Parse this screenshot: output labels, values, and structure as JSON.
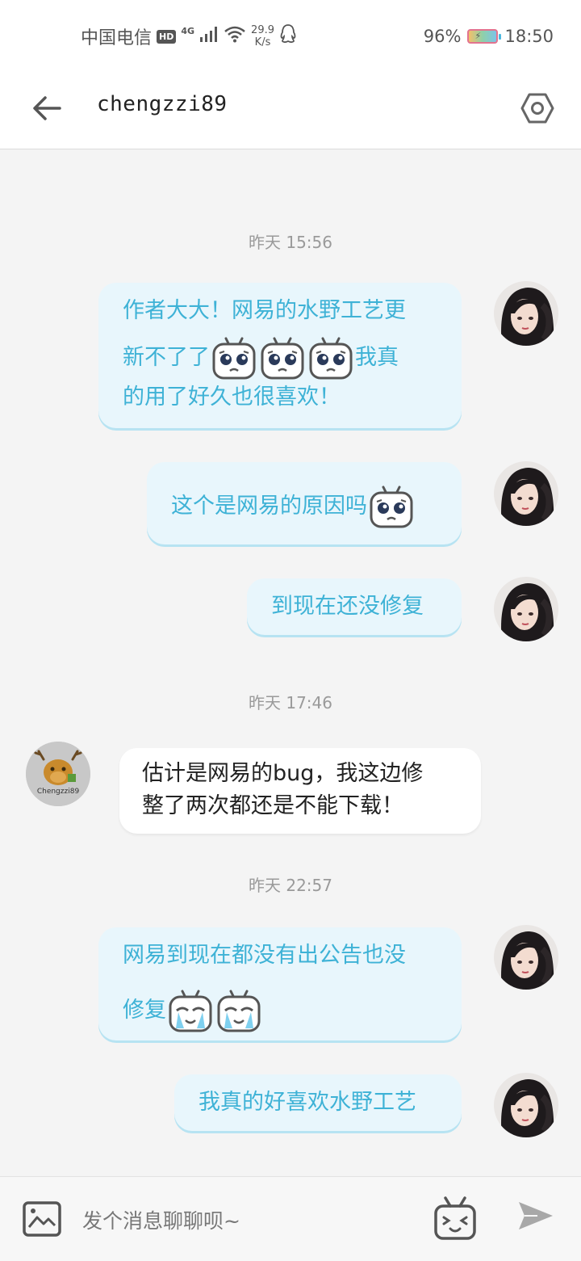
{
  "status_bar": {
    "carrier": "中国电信",
    "hd_badge": "HD",
    "network": "4G",
    "speed_value": "29.9",
    "speed_unit": "K/s",
    "battery": "96%",
    "time": "18:50",
    "icons": [
      "hd-badge-icon",
      "signal-icon",
      "wifi-icon",
      "qq-notification-icon",
      "battery-charging-icon"
    ]
  },
  "header": {
    "back_icon": "arrow-left-icon",
    "title": "chengzzi89",
    "settings_icon": "hexagon-settings-icon"
  },
  "colors": {
    "outgoing_bubble_bg": "#e8f6fc",
    "outgoing_text": "#3eb2d6",
    "incoming_bubble_bg": "#ffffff",
    "incoming_text": "#222222",
    "timestamp_text": "#9a9a9a",
    "page_bg": "#f4f4f4"
  },
  "messages": {
    "time_1": "昨天 15:56",
    "m1": {
      "line1": "作者大大！网易的水野工艺更",
      "line2a": "新不了了",
      "line2b": "我真",
      "line3": "的用了好久也很喜欢！",
      "emoji": "crying-tv-emoji"
    },
    "m2": {
      "text": "这个是网易的原因吗",
      "emoji": "crying-tv-emoji"
    },
    "m3": {
      "text": "到现在还没修复"
    },
    "time_2": "昨天 17:46",
    "m4": {
      "line1": "估计是网易的bug，我这边修",
      "line2": "整了两次都还是不能下载！"
    },
    "time_3": "昨天 22:57",
    "m5": {
      "line1": "网易到现在都没有出公告也没",
      "line2": "修复",
      "emoji": "tears-tv-emoji"
    },
    "m6": {
      "text": "我真的好喜欢水野工艺"
    }
  },
  "avatars": {
    "outgoing": "anime-girl-avatar",
    "incoming": "deer-avatar",
    "incoming_caption": "Chengzzi89"
  },
  "input_bar": {
    "image_icon": "image-picker-icon",
    "placeholder": "发个消息聊聊呗~",
    "sticker_icon": "tv-sticker-icon",
    "send_icon": "send-icon"
  }
}
